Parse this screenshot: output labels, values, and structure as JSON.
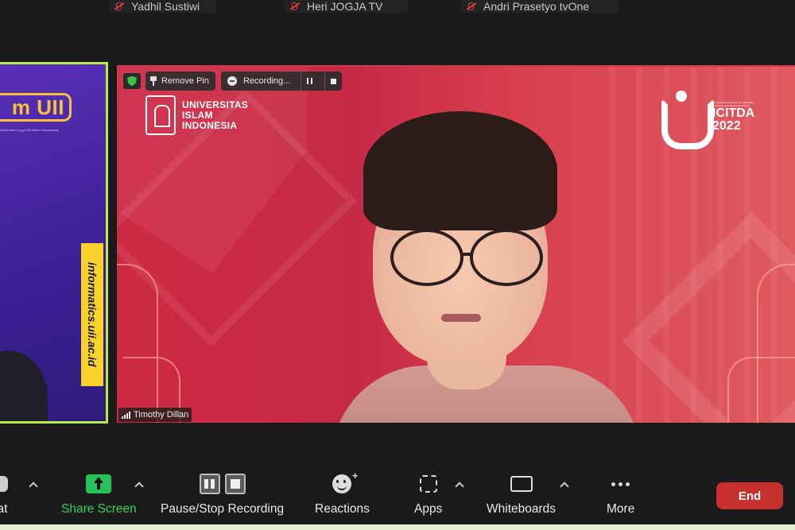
{
  "participants": [
    {
      "name": "Yadhil Sustiwi"
    },
    {
      "name": "Heri JOGJA TV"
    },
    {
      "name": "Andri Prasetyo tvOne"
    }
  ],
  "left_video": {
    "logo_text": "m UII",
    "tagline": "Informatika Unggul Berkelas Internasional",
    "url": "informatics.uii.ac.id"
  },
  "main_video": {
    "uii_logo_lines": [
      "UNIVERSITAS",
      "ISLAM",
      "INDONESIA"
    ],
    "icitda_subtitle": "International Conference on Informatics Technology and Digital Applications",
    "icitda_title": "ICITDA",
    "icitda_year": "2022",
    "speaker_name": "Timothy Dillan"
  },
  "overlays": {
    "remove_pin_label": "Remove Pin",
    "recording_label": "Recording..."
  },
  "toolbar": {
    "chat_label": "at",
    "share_screen_label": "Share Screen",
    "pause_stop_label": "Pause/Stop Recording",
    "reactions_label": "Reactions",
    "apps_label": "Apps",
    "whiteboards_label": "Whiteboards",
    "more_label": "More",
    "end_label": "End"
  },
  "colors": {
    "active_speaker_border": "#b8ea4a",
    "share_green": "#25c25a",
    "end_red": "#c7312d",
    "share_label": "#2fd35f"
  }
}
